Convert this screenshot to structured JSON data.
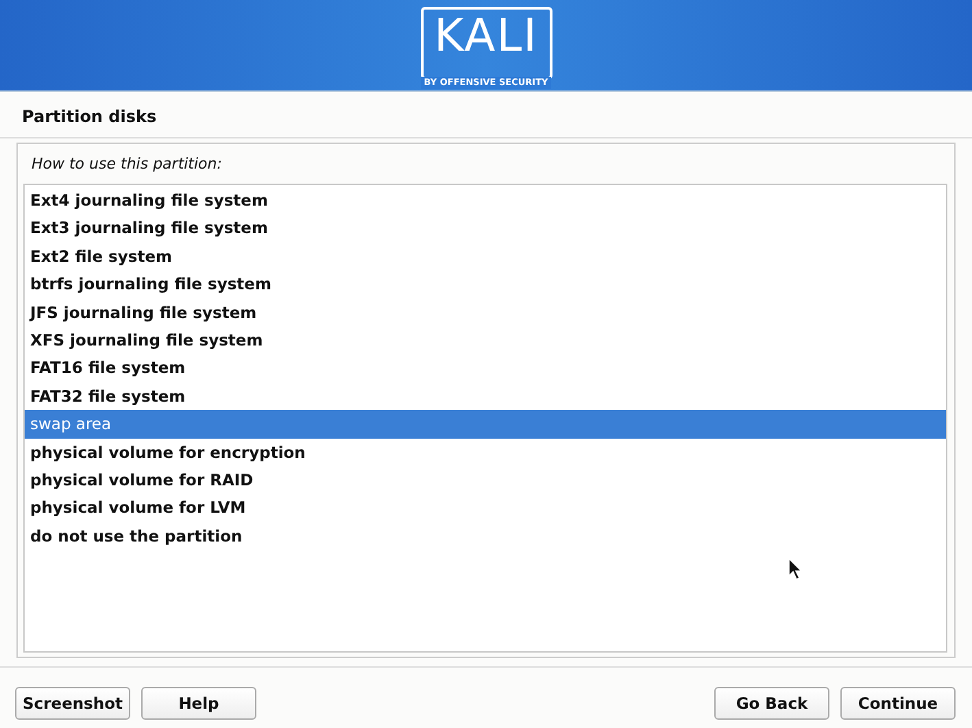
{
  "header": {
    "logo_text": "KALI",
    "logo_tagline": "BY OFFENSIVE SECURITY"
  },
  "title": "Partition disks",
  "prompt": "How to use this partition:",
  "options": [
    {
      "label": "Ext4 journaling file system",
      "selected": false
    },
    {
      "label": "Ext3 journaling file system",
      "selected": false
    },
    {
      "label": "Ext2 file system",
      "selected": false
    },
    {
      "label": "btrfs journaling file system",
      "selected": false
    },
    {
      "label": "JFS journaling file system",
      "selected": false
    },
    {
      "label": "XFS journaling file system",
      "selected": false
    },
    {
      "label": "FAT16 file system",
      "selected": false
    },
    {
      "label": "FAT32 file system",
      "selected": false
    },
    {
      "label": "swap area",
      "selected": true
    },
    {
      "label": "physical volume for encryption",
      "selected": false
    },
    {
      "label": "physical volume for RAID",
      "selected": false
    },
    {
      "label": "physical volume for LVM",
      "selected": false
    },
    {
      "label": "do not use the partition",
      "selected": false
    }
  ],
  "buttons_left": [
    "Screenshot",
    "Help"
  ],
  "buttons_right": [
    "Go Back",
    "Continue"
  ]
}
